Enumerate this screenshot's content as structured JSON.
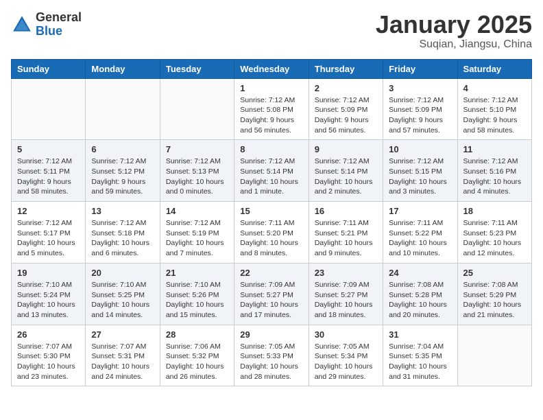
{
  "header": {
    "logo_general": "General",
    "logo_blue": "Blue",
    "month_title": "January 2025",
    "location": "Suqian, Jiangsu, China"
  },
  "weekdays": [
    "Sunday",
    "Monday",
    "Tuesday",
    "Wednesday",
    "Thursday",
    "Friday",
    "Saturday"
  ],
  "weeks": [
    [
      {
        "day": "",
        "info": ""
      },
      {
        "day": "",
        "info": ""
      },
      {
        "day": "",
        "info": ""
      },
      {
        "day": "1",
        "info": "Sunrise: 7:12 AM\nSunset: 5:08 PM\nDaylight: 9 hours\nand 56 minutes."
      },
      {
        "day": "2",
        "info": "Sunrise: 7:12 AM\nSunset: 5:09 PM\nDaylight: 9 hours\nand 56 minutes."
      },
      {
        "day": "3",
        "info": "Sunrise: 7:12 AM\nSunset: 5:09 PM\nDaylight: 9 hours\nand 57 minutes."
      },
      {
        "day": "4",
        "info": "Sunrise: 7:12 AM\nSunset: 5:10 PM\nDaylight: 9 hours\nand 58 minutes."
      }
    ],
    [
      {
        "day": "5",
        "info": "Sunrise: 7:12 AM\nSunset: 5:11 PM\nDaylight: 9 hours\nand 58 minutes."
      },
      {
        "day": "6",
        "info": "Sunrise: 7:12 AM\nSunset: 5:12 PM\nDaylight: 9 hours\nand 59 minutes."
      },
      {
        "day": "7",
        "info": "Sunrise: 7:12 AM\nSunset: 5:13 PM\nDaylight: 10 hours\nand 0 minutes."
      },
      {
        "day": "8",
        "info": "Sunrise: 7:12 AM\nSunset: 5:14 PM\nDaylight: 10 hours\nand 1 minute."
      },
      {
        "day": "9",
        "info": "Sunrise: 7:12 AM\nSunset: 5:14 PM\nDaylight: 10 hours\nand 2 minutes."
      },
      {
        "day": "10",
        "info": "Sunrise: 7:12 AM\nSunset: 5:15 PM\nDaylight: 10 hours\nand 3 minutes."
      },
      {
        "day": "11",
        "info": "Sunrise: 7:12 AM\nSunset: 5:16 PM\nDaylight: 10 hours\nand 4 minutes."
      }
    ],
    [
      {
        "day": "12",
        "info": "Sunrise: 7:12 AM\nSunset: 5:17 PM\nDaylight: 10 hours\nand 5 minutes."
      },
      {
        "day": "13",
        "info": "Sunrise: 7:12 AM\nSunset: 5:18 PM\nDaylight: 10 hours\nand 6 minutes."
      },
      {
        "day": "14",
        "info": "Sunrise: 7:12 AM\nSunset: 5:19 PM\nDaylight: 10 hours\nand 7 minutes."
      },
      {
        "day": "15",
        "info": "Sunrise: 7:11 AM\nSunset: 5:20 PM\nDaylight: 10 hours\nand 8 minutes."
      },
      {
        "day": "16",
        "info": "Sunrise: 7:11 AM\nSunset: 5:21 PM\nDaylight: 10 hours\nand 9 minutes."
      },
      {
        "day": "17",
        "info": "Sunrise: 7:11 AM\nSunset: 5:22 PM\nDaylight: 10 hours\nand 10 minutes."
      },
      {
        "day": "18",
        "info": "Sunrise: 7:11 AM\nSunset: 5:23 PM\nDaylight: 10 hours\nand 12 minutes."
      }
    ],
    [
      {
        "day": "19",
        "info": "Sunrise: 7:10 AM\nSunset: 5:24 PM\nDaylight: 10 hours\nand 13 minutes."
      },
      {
        "day": "20",
        "info": "Sunrise: 7:10 AM\nSunset: 5:25 PM\nDaylight: 10 hours\nand 14 minutes."
      },
      {
        "day": "21",
        "info": "Sunrise: 7:10 AM\nSunset: 5:26 PM\nDaylight: 10 hours\nand 15 minutes."
      },
      {
        "day": "22",
        "info": "Sunrise: 7:09 AM\nSunset: 5:27 PM\nDaylight: 10 hours\nand 17 minutes."
      },
      {
        "day": "23",
        "info": "Sunrise: 7:09 AM\nSunset: 5:27 PM\nDaylight: 10 hours\nand 18 minutes."
      },
      {
        "day": "24",
        "info": "Sunrise: 7:08 AM\nSunset: 5:28 PM\nDaylight: 10 hours\nand 20 minutes."
      },
      {
        "day": "25",
        "info": "Sunrise: 7:08 AM\nSunset: 5:29 PM\nDaylight: 10 hours\nand 21 minutes."
      }
    ],
    [
      {
        "day": "26",
        "info": "Sunrise: 7:07 AM\nSunset: 5:30 PM\nDaylight: 10 hours\nand 23 minutes."
      },
      {
        "day": "27",
        "info": "Sunrise: 7:07 AM\nSunset: 5:31 PM\nDaylight: 10 hours\nand 24 minutes."
      },
      {
        "day": "28",
        "info": "Sunrise: 7:06 AM\nSunset: 5:32 PM\nDaylight: 10 hours\nand 26 minutes."
      },
      {
        "day": "29",
        "info": "Sunrise: 7:05 AM\nSunset: 5:33 PM\nDaylight: 10 hours\nand 28 minutes."
      },
      {
        "day": "30",
        "info": "Sunrise: 7:05 AM\nSunset: 5:34 PM\nDaylight: 10 hours\nand 29 minutes."
      },
      {
        "day": "31",
        "info": "Sunrise: 7:04 AM\nSunset: 5:35 PM\nDaylight: 10 hours\nand 31 minutes."
      },
      {
        "day": "",
        "info": ""
      }
    ]
  ]
}
